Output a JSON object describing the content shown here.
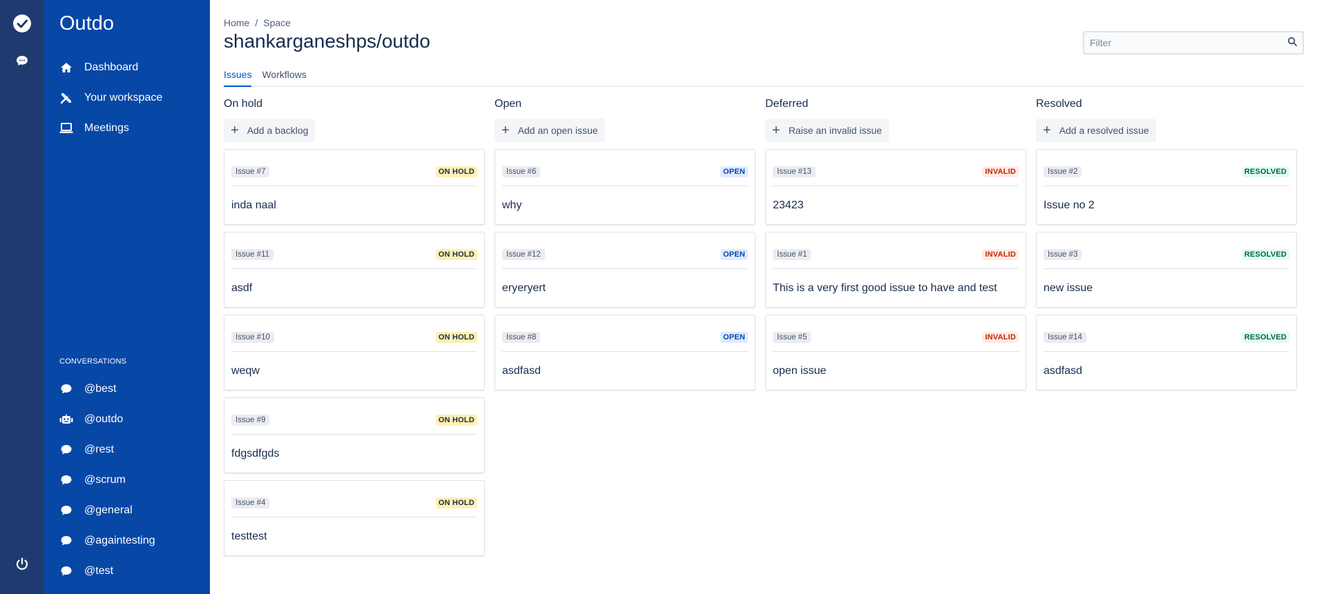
{
  "app": {
    "brand": "Outdo"
  },
  "sidebar": {
    "nav": [
      {
        "label": "Dashboard",
        "icon": "home-icon"
      },
      {
        "label": "Your workspace",
        "icon": "tools-icon"
      },
      {
        "label": "Meetings",
        "icon": "laptop-icon"
      }
    ],
    "conversations_heading": "CONVERSATIONS",
    "conversations": [
      {
        "label": "@best",
        "icon": "chat-icon"
      },
      {
        "label": "@outdo",
        "icon": "robot-icon"
      },
      {
        "label": "@rest",
        "icon": "chat-icon"
      },
      {
        "label": "@scrum",
        "icon": "chat-icon"
      },
      {
        "label": "@general",
        "icon": "chat-icon"
      },
      {
        "label": "@againtesting",
        "icon": "chat-icon"
      },
      {
        "label": "@test",
        "icon": "chat-icon"
      }
    ]
  },
  "breadcrumb": {
    "home": "Home",
    "sep": "/",
    "space": "Space"
  },
  "page": {
    "title": "shankarganeshps/outdo"
  },
  "filter": {
    "placeholder": "Filter"
  },
  "tabs": [
    {
      "label": "Issues",
      "active": true
    },
    {
      "label": "Workflows",
      "active": false
    }
  ],
  "colors": {
    "sidebar": "#0747a6",
    "rail": "#1f3a6e",
    "accent": "#0052cc"
  },
  "columns": [
    {
      "title": "On hold",
      "add_label": "Add a backlog",
      "status_class": "st-hold",
      "cards": [
        {
          "id": "Issue #7",
          "status": "ON HOLD",
          "title": "inda naal"
        },
        {
          "id": "Issue #11",
          "status": "ON HOLD",
          "title": "asdf"
        },
        {
          "id": "Issue #10",
          "status": "ON HOLD",
          "title": "weqw"
        },
        {
          "id": "Issue #9",
          "status": "ON HOLD",
          "title": "fdgsdfgds"
        },
        {
          "id": "Issue #4",
          "status": "ON HOLD",
          "title": "testtest"
        }
      ]
    },
    {
      "title": "Open",
      "add_label": "Add an open issue",
      "status_class": "st-open",
      "cards": [
        {
          "id": "Issue #6",
          "status": "OPEN",
          "title": "why"
        },
        {
          "id": "Issue #12",
          "status": "OPEN",
          "title": "eryeryert"
        },
        {
          "id": "Issue #8",
          "status": "OPEN",
          "title": "asdfasd"
        }
      ]
    },
    {
      "title": "Deferred",
      "add_label": "Raise an invalid issue",
      "status_class": "st-invalid",
      "cards": [
        {
          "id": "Issue #13",
          "status": "INVALID",
          "title": "23423"
        },
        {
          "id": "Issue #1",
          "status": "INVALID",
          "title": "This is a very first good issue to have and test"
        },
        {
          "id": "Issue #5",
          "status": "INVALID",
          "title": "open issue"
        }
      ]
    },
    {
      "title": "Resolved",
      "add_label": "Add a resolved issue",
      "status_class": "st-resolved",
      "cards": [
        {
          "id": "Issue #2",
          "status": "RESOLVED",
          "title": "Issue no 2"
        },
        {
          "id": "Issue #3",
          "status": "RESOLVED",
          "title": "new issue"
        },
        {
          "id": "Issue #14",
          "status": "RESOLVED",
          "title": "asdfasd"
        }
      ]
    }
  ]
}
